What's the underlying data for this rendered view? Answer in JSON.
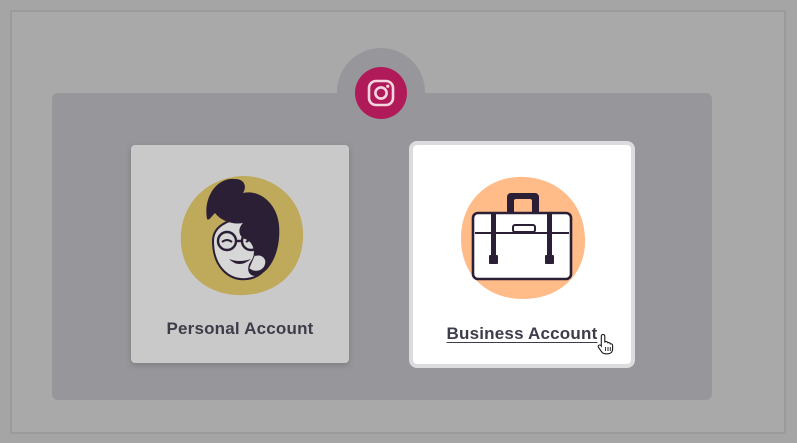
{
  "app": {
    "logo_icon": "instagram-logo-icon",
    "brand_color": "#b01a58"
  },
  "cards": [
    {
      "label": "Personal Account",
      "icon": "person-avatar-icon",
      "accent": "#bfa95a",
      "state": "default"
    },
    {
      "label": "Business Account",
      "icon": "briefcase-icon",
      "accent": "#ffbb88",
      "state": "hovered"
    }
  ],
  "cursor": {
    "icon": "hand-pointer-icon"
  }
}
